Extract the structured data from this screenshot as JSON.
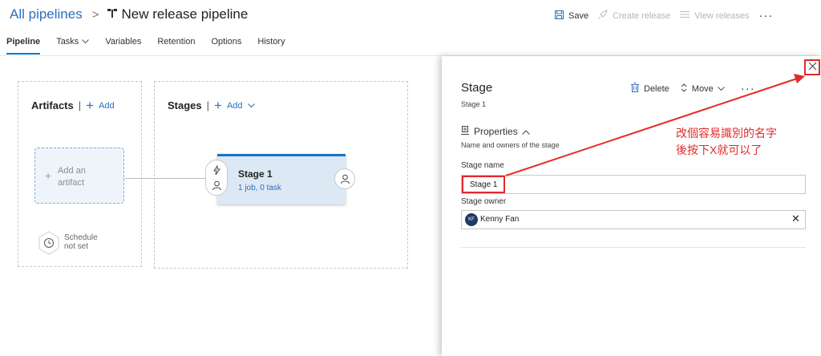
{
  "header": {
    "breadcrumb_link": "All pipelines",
    "breadcrumb_sep": ">",
    "pipeline_title": "New release pipeline",
    "save_label": "Save",
    "create_release_label": "Create release",
    "view_releases_label": "View releases",
    "more_label": "···"
  },
  "tabs": [
    {
      "label": "Pipeline"
    },
    {
      "label": "Tasks"
    },
    {
      "label": "Variables"
    },
    {
      "label": "Retention"
    },
    {
      "label": "Options"
    },
    {
      "label": "History"
    }
  ],
  "canvas": {
    "artifacts_title": "Artifacts",
    "artifacts_add": "Add",
    "stages_title": "Stages",
    "stages_add": "Add",
    "artifact_placeholder_line1": "Add an",
    "artifact_placeholder_line2": "artifact",
    "schedule_line1": "Schedule",
    "schedule_line2": "not set",
    "stage_card": {
      "name": "Stage 1",
      "summary": "1 job, 0 task"
    }
  },
  "panel": {
    "title": "Stage",
    "subtitle": "Stage 1",
    "delete_label": "Delete",
    "move_label": "Move",
    "more_label": "···",
    "properties_label": "Properties",
    "properties_desc": "Name and owners of the stage",
    "stage_name_label": "Stage name",
    "stage_name_value": "Stage 1",
    "stage_owner_label": "Stage owner",
    "owner_initials": "KF",
    "owner_name": "Kenny Fan"
  },
  "annotation": {
    "line1": "改個容易識別的名字",
    "line2": "後按下X就可以了",
    "color": "#e02b2b"
  },
  "colors": {
    "accent": "#0078d4",
    "link": "#2d6fbb",
    "stage_fill": "#dce9f5"
  }
}
